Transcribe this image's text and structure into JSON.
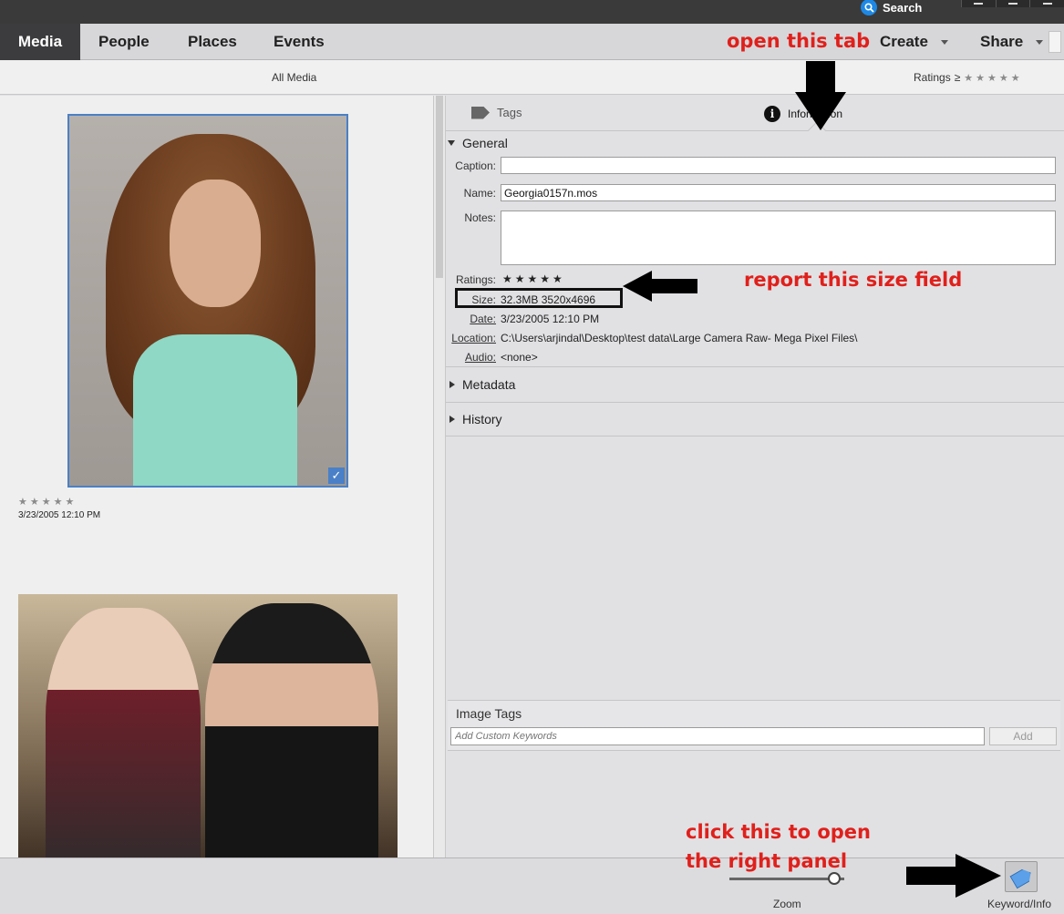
{
  "titlebar": {
    "search_label": "Search"
  },
  "nav": {
    "tabs": [
      "Media",
      "People",
      "Places",
      "Events"
    ],
    "active": "Media",
    "create_label": "Create",
    "share_label": "Share"
  },
  "subbar": {
    "all_media": "All Media",
    "ratings_label": "Ratings",
    "ratings_op": "≥"
  },
  "grid": {
    "items": [
      {
        "date": "3/23/2005 12:10 PM",
        "selected": true,
        "rating": 0
      }
    ]
  },
  "panel": {
    "tabs": {
      "tags": "Tags",
      "information": "Information"
    },
    "general": {
      "title": "General",
      "caption_label": "Caption:",
      "caption_value": "",
      "name_label": "Name:",
      "name_value": "Georgia0157n.mos",
      "notes_label": "Notes:",
      "notes_value": "",
      "ratings_label": "Ratings:",
      "size_label": "Size:",
      "size_value": "32.3MB  3520x4696",
      "date_label": "Date:",
      "date_value": "3/23/2005 12:10 PM",
      "location_label": "Location:",
      "location_value": "C:\\Users\\arjindal\\Desktop\\test data\\Large Camera Raw- Mega Pixel Files\\",
      "audio_label": "Audio:",
      "audio_value": "<none>"
    },
    "metadata_title": "Metadata",
    "history_title": "History",
    "image_tags": {
      "title": "Image Tags",
      "placeholder": "Add Custom Keywords",
      "add_label": "Add"
    }
  },
  "bottombar": {
    "zoom_label": "Zoom",
    "keyword_info_label": "Keyword/Info"
  },
  "annotations": {
    "open_tab": "open this tab",
    "report_size": "report this size field",
    "click_line1": "click this to open",
    "click_line2": "the right panel"
  },
  "colors": {
    "accent": "#4a80c7",
    "annotation": "#e0201b",
    "active_tab_bg": "#3c3c3e"
  }
}
